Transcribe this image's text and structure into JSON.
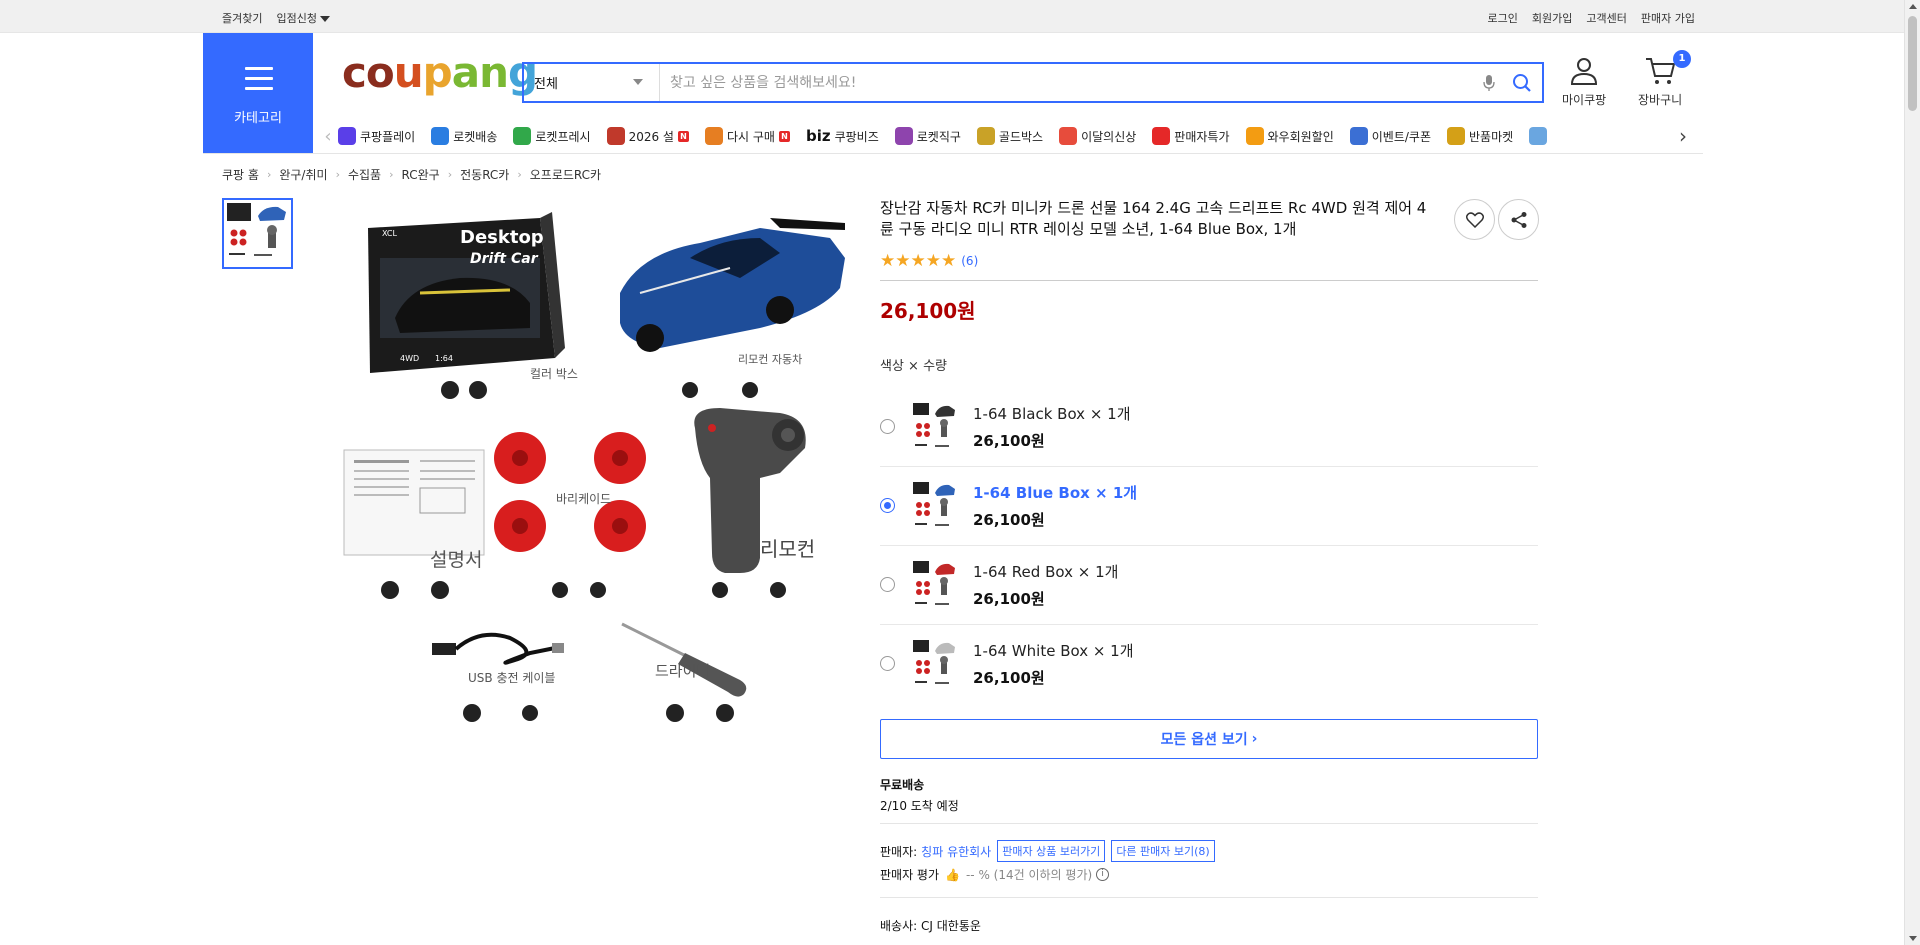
{
  "topbar": {
    "left": [
      "즐겨찾기",
      "입점신청"
    ],
    "right": [
      "로그인",
      "회원가입",
      "고객센터",
      "판매자 가입"
    ]
  },
  "header": {
    "category_label": "카테고리",
    "logo": [
      "co",
      "u",
      "p",
      "an",
      "g"
    ],
    "search_scope": "전체",
    "search_placeholder": "찾고 싶은 상품을 검색해보세요!",
    "mypage_label": "마이쿠팡",
    "cart_label": "장바구니",
    "cart_count": "1"
  },
  "nav": [
    {
      "label": "쿠팡플레이",
      "color": "#5a3fe8"
    },
    {
      "label": "로켓배송",
      "color": "#2a7de1"
    },
    {
      "label": "로켓프레시",
      "color": "#31a84a"
    },
    {
      "label": "2026 설",
      "color": "#c0392b",
      "badge": "N"
    },
    {
      "label": "다시 구매",
      "color": "#e67e22",
      "badge": "N"
    },
    {
      "label": "쿠팡비즈",
      "color": "#111111",
      "biz": "biz"
    },
    {
      "label": "로켓직구",
      "color": "#8e44ad"
    },
    {
      "label": "골드박스",
      "color": "#c9a227"
    },
    {
      "label": "이달의신상",
      "color": "#e74c3c"
    },
    {
      "label": "판매자특가",
      "color": "#e52828"
    },
    {
      "label": "와우회원할인",
      "color": "#f39c12"
    },
    {
      "label": "이벤트/쿠폰",
      "color": "#3b6fd4"
    },
    {
      "label": "반품마켓",
      "color": "#d4a017"
    },
    {
      "label": "",
      "color": "#6aa6e0"
    }
  ],
  "breadcrumb": [
    "쿠팡 홈",
    "완구/취미",
    "수집품",
    "RC완구",
    "전동RC카",
    "오프로드RC카"
  ],
  "gallery": {
    "labels": [
      "컬러 박스",
      "리모컨 자동차",
      "바리케이드",
      "설명서",
      "리모컨",
      "USB 충전 케이블",
      "드라이버"
    ],
    "box_text": [
      "Desktop",
      "Drift Car",
      "4WD",
      "1:64",
      "XCL"
    ]
  },
  "product": {
    "title": "장난감 자동차 RC카 미니카 드론 선물 164 2.4G 고속 드리프트 Rc 4WD 원격 제어 4 륜 구동 라디오 미니 RTR 레이싱 모델 소년, 1-64 Blue Box, 1개",
    "rating_stars": 5,
    "review_count": "(6)",
    "price": "26,100원",
    "option_label": "색상 × 수량",
    "options": [
      {
        "name": "1-64 Black Box × 1개",
        "price": "26,100원",
        "selected": false,
        "car_color": "#333333"
      },
      {
        "name": "1-64 Blue Box × 1개",
        "price": "26,100원",
        "selected": true,
        "car_color": "#2f63b8"
      },
      {
        "name": "1-64 Red Box × 1개",
        "price": "26,100원",
        "selected": false,
        "car_color": "#c22828"
      },
      {
        "name": "1-64 White Box × 1개",
        "price": "26,100원",
        "selected": false,
        "car_color": "#bbbbbb"
      }
    ],
    "all_options_label": "모든 옵션 보기",
    "shipping_title": "무료배송",
    "arrival": "2/10 도착 예정",
    "seller_label": "판매자:",
    "seller_name": "칭파 유한회사",
    "seller_products_label": "판매자 상품 보러가기",
    "other_sellers_label": "다른 판매자 보기(8)",
    "seller_rating_label": "판매자 평가",
    "seller_rating_value": "-- % (14건 이하의 평가)",
    "info_icon_text": "i",
    "delivery_label": "배송사:",
    "delivery_company": "CJ 대한통운"
  }
}
